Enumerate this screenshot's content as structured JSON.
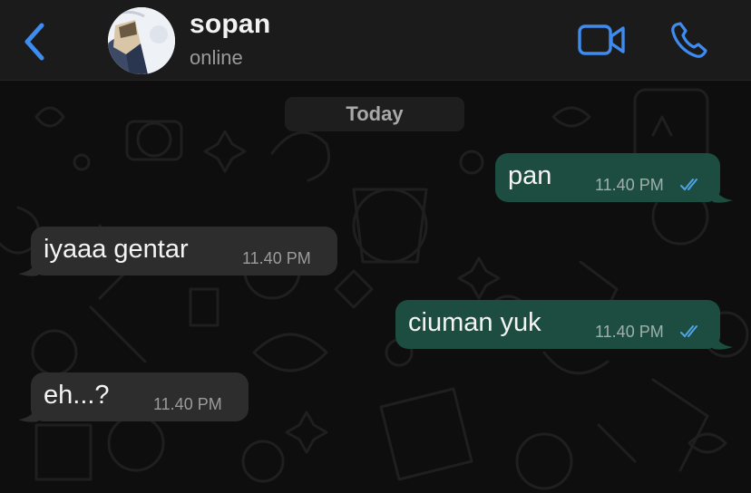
{
  "header": {
    "contact_name": "sopan",
    "status": "online",
    "icons": {
      "back": "chevron-left-icon",
      "video": "video-camera-icon",
      "call": "phone-icon"
    },
    "accent_color": "#3f8cf0"
  },
  "chat": {
    "date_label": "Today",
    "messages": [
      {
        "direction": "outgoing",
        "text": "pan",
        "time": "11.40 PM",
        "status": "read"
      },
      {
        "direction": "incoming",
        "text": "iyaaa gentar",
        "time": "11.40 PM"
      },
      {
        "direction": "outgoing",
        "text": "ciuman yuk",
        "time": "11.40 PM",
        "status": "read"
      },
      {
        "direction": "incoming",
        "text": "eh...?",
        "time": "11.40 PM"
      }
    ],
    "colors": {
      "outgoing_bubble": "#1d4d41",
      "incoming_bubble": "#2d2d2e",
      "read_ticks": "#4fa3e8"
    }
  }
}
